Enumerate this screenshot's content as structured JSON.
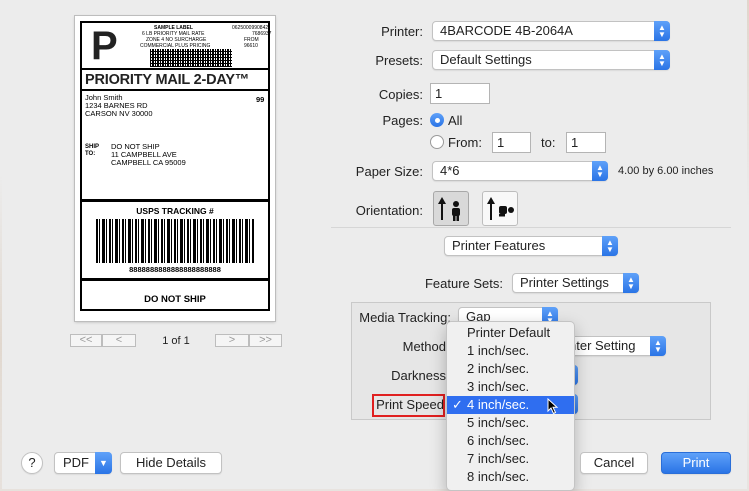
{
  "preview": {
    "sample_label": "SAMPLE LABEL",
    "lbs_line": "6 LB PRIORITY MAIL RATE",
    "zone_line": "ZONE 4 NO SURCHARGE",
    "commercial_line": "COMMERCIAL PLUS PRICING",
    "code1": "0625000990842",
    "code2": "7686937",
    "code3": "FROM 96610",
    "big_letter": "P",
    "service": "PRIORITY MAIL 2-DAY™",
    "from_name": "John Smith",
    "from_street": "1234 BARNES RD",
    "from_city": "CARSON NV 30000",
    "weight_code": "99",
    "ship_to_label": "SHIP\nTO:",
    "to_line1": "DO NOT SHIP",
    "to_line2": "11 CAMPBELL AVE",
    "to_line3": "CAMPBELL CA 95009",
    "tracking_label": "USPS TRACKING #",
    "tracking_number": "8888888888888888888888",
    "footer": "DO NOT SHIP"
  },
  "pagination": {
    "first": "<<",
    "prev": "<",
    "page_text": "1 of 1",
    "next": ">",
    "last": ">>"
  },
  "form": {
    "printer_label": "Printer:",
    "printer_value": "4BARCODE 4B-2064A",
    "presets_label": "Presets:",
    "presets_value": "Default Settings",
    "copies_label": "Copies:",
    "copies_value": "1",
    "pages_label": "Pages:",
    "pages_all": "All",
    "pages_from": "From:",
    "pages_from_value": "1",
    "pages_to": "to:",
    "pages_to_value": "1",
    "paper_label": "Paper Size:",
    "paper_value": "4*6",
    "paper_desc": "4.00 by 6.00 inches",
    "orientation_label": "Orientation:",
    "section_value": "Printer Features",
    "feature_sets_label": "Feature Sets:",
    "feature_sets_value": "Printer Settings",
    "media_label": "Media Tracking:",
    "media_value": "Gap",
    "method_label": "Method",
    "method_value": "nter Setting",
    "darkness_label": "Darkness",
    "speed_label": "Print Speed"
  },
  "speed_menu": {
    "items": [
      "Printer Default",
      "1 inch/sec.",
      "2 inch/sec.",
      "3 inch/sec.",
      "4 inch/sec.",
      "5 inch/sec.",
      "6 inch/sec.",
      "7 inch/sec.",
      "8 inch/sec."
    ],
    "selected": "4 inch/sec.",
    "check": "✓"
  },
  "buttons": {
    "help": "?",
    "pdf": "PDF",
    "hide_details": "Hide Details",
    "cancel": "Cancel",
    "print": "Print"
  },
  "colors": {
    "accent": "#2f6ef0",
    "highlight_box": "#e02020"
  }
}
